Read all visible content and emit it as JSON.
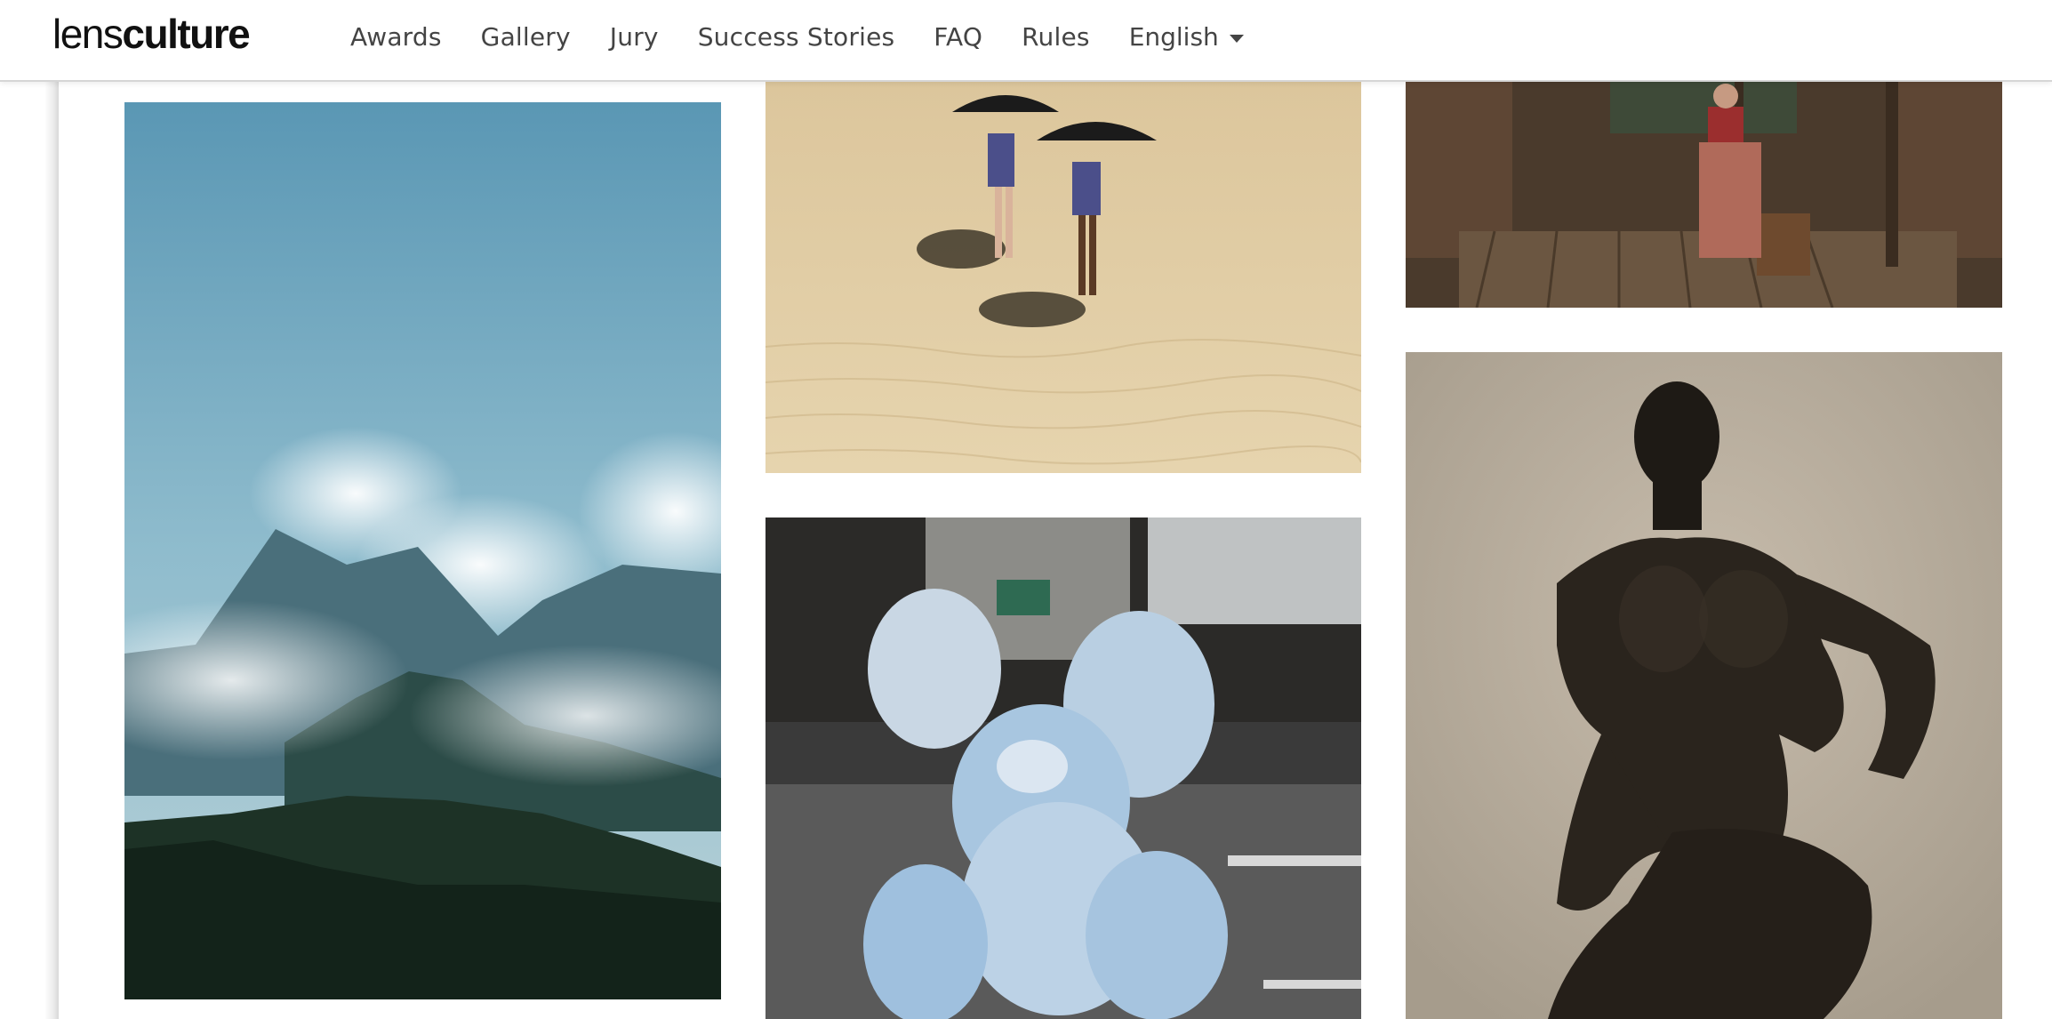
{
  "site": {
    "logo_light": "lens",
    "logo_bold": "culture"
  },
  "nav": {
    "items": [
      "Awards",
      "Gallery",
      "Jury",
      "Success Stories",
      "FAQ",
      "Rules"
    ],
    "language": "English"
  },
  "gallery": {
    "photos": [
      {
        "subject": "misty-mountains-forest"
      },
      {
        "subject": "two-women-umbrellas-desert"
      },
      {
        "subject": "plastic-bags-street"
      },
      {
        "subject": "woman-seated-old-porch"
      },
      {
        "subject": "man-portrait-sepia"
      }
    ]
  },
  "colors": {
    "nav_text": "#444444",
    "logo": "#111111",
    "header_border": "#d6d6d6"
  }
}
